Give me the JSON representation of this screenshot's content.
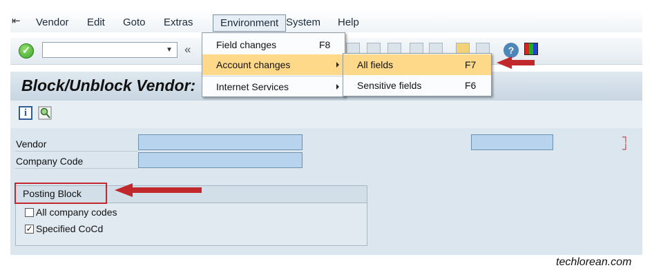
{
  "menubar": {
    "items": [
      "Vendor",
      "Edit",
      "Goto",
      "Extras",
      "Environment",
      "System",
      "Help"
    ]
  },
  "environment_menu": {
    "items": [
      {
        "label": "Field changes",
        "key": "F8"
      },
      {
        "label": "Account changes",
        "key": ""
      },
      {
        "label": "Internet Services",
        "key": ""
      }
    ]
  },
  "account_changes_submenu": {
    "items": [
      {
        "label": "All fields",
        "key": "F7"
      },
      {
        "label": "Sensitive fields",
        "key": "F6"
      }
    ]
  },
  "page": {
    "title": "Block/Unblock Vendor:"
  },
  "form": {
    "vendor_label": "Vendor",
    "company_code_label": "Company Code"
  },
  "posting_block": {
    "title": "Posting Block",
    "options": [
      {
        "label": "All company codes",
        "checked": false
      },
      {
        "label": "Specified CoCd",
        "checked": true
      }
    ]
  },
  "watermark": "techlorean.com",
  "colors": {
    "highlight": "#ffd98a",
    "annotation_red": "#c0282b",
    "input_fill": "#b7d3ee"
  }
}
